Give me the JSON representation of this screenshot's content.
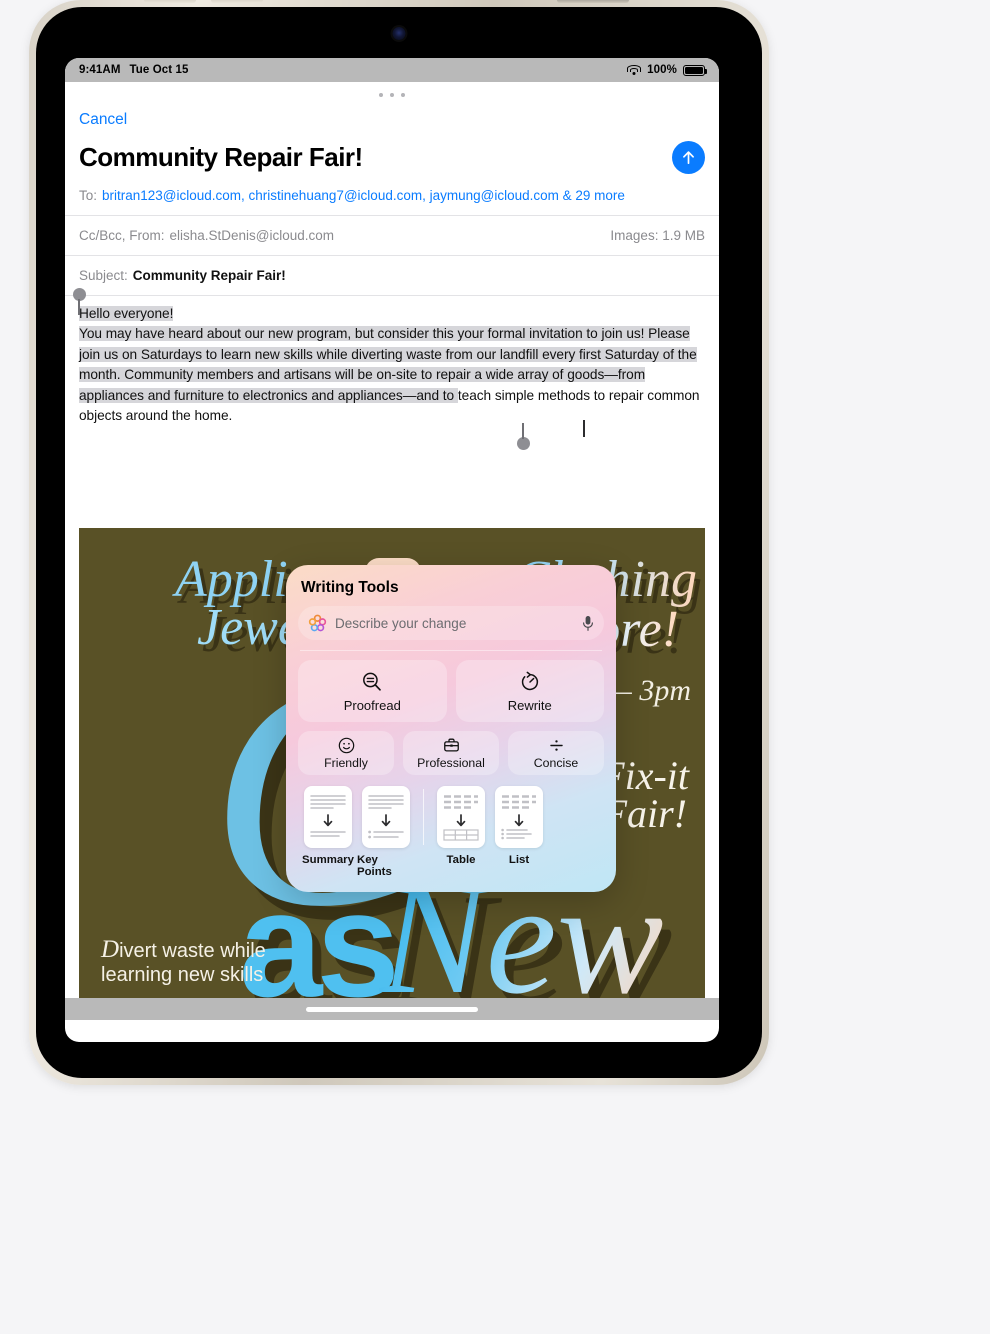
{
  "status_bar": {
    "time": "9:41AM",
    "date": "Tue Oct 15",
    "battery_percent": "100%",
    "wifi_icon": "wifi-icon",
    "battery_icon": "battery-full-icon"
  },
  "compose": {
    "cancel_label": "Cancel",
    "title": "Community Repair Fair!",
    "send_icon": "send-arrow-up-icon",
    "grabber_icon": "sheet-grabber-icon",
    "to_label": "To:",
    "to_value": "britran123@icloud.com, christinehuang7@icloud.com, jaymung@icloud.com & 29 more",
    "ccbcc_label": "Cc/Bcc, From:",
    "from_value": "elisha.StDenis@icloud.com",
    "images_label": "Images:",
    "images_size": "1.9 MB",
    "subject_label": "Subject:",
    "subject_value": "Community Repair Fair!",
    "body": {
      "line1": "Hello everyone!",
      "selected": "You may have heard about our new program, but consider this your formal invitation to join us! Please join us on Saturdays to learn new skills while diverting waste from our landfill every first Saturday of the month. Community members and artisans will be on-site to repair a wide array of goods—from appliances and furniture to electronics and appliances—and to ",
      "tail": "teach simple methods to repair common objects around the home."
    }
  },
  "poster": {
    "appliances": "Appliances",
    "jewelry": "Jewelry",
    "clothing": "Clothing",
    "more": "More!",
    "hours": "9am — 3pm",
    "fixit": "Fix-it",
    "fair": "Fair!",
    "big_as": "as",
    "big_new": "New",
    "swirl": "G",
    "divert_em": "D",
    "divert_rest": "ivert waste while learning new skills"
  },
  "writing_tools": {
    "title": "Writing Tools",
    "search_placeholder": "Describe your change",
    "ai_icon": "apple-intelligence-icon",
    "mic_icon": "microphone-icon",
    "actions": [
      {
        "label": "Proofread",
        "icon": "magnifier-lines-icon"
      },
      {
        "label": "Rewrite",
        "icon": "rewrite-clock-icon"
      }
    ],
    "tones": [
      {
        "label": "Friendly",
        "icon": "smiley-face-icon"
      },
      {
        "label": "Professional",
        "icon": "briefcase-icon"
      },
      {
        "label": "Concise",
        "icon": "divide-icon"
      }
    ],
    "formats": [
      {
        "label": "Summary",
        "icon": "doc-summary-icon"
      },
      {
        "label": "Key Points",
        "icon": "doc-keypoints-icon"
      },
      {
        "label": "Table",
        "icon": "doc-table-icon"
      },
      {
        "label": "List",
        "icon": "doc-list-icon"
      }
    ]
  },
  "colors": {
    "accent_blue": "#0a7cff",
    "poster_bg": "#595126",
    "poster_shadow": "#3a3316",
    "poster_cyan": "#4fc0f0",
    "selection_gray": "#d6d6da"
  }
}
